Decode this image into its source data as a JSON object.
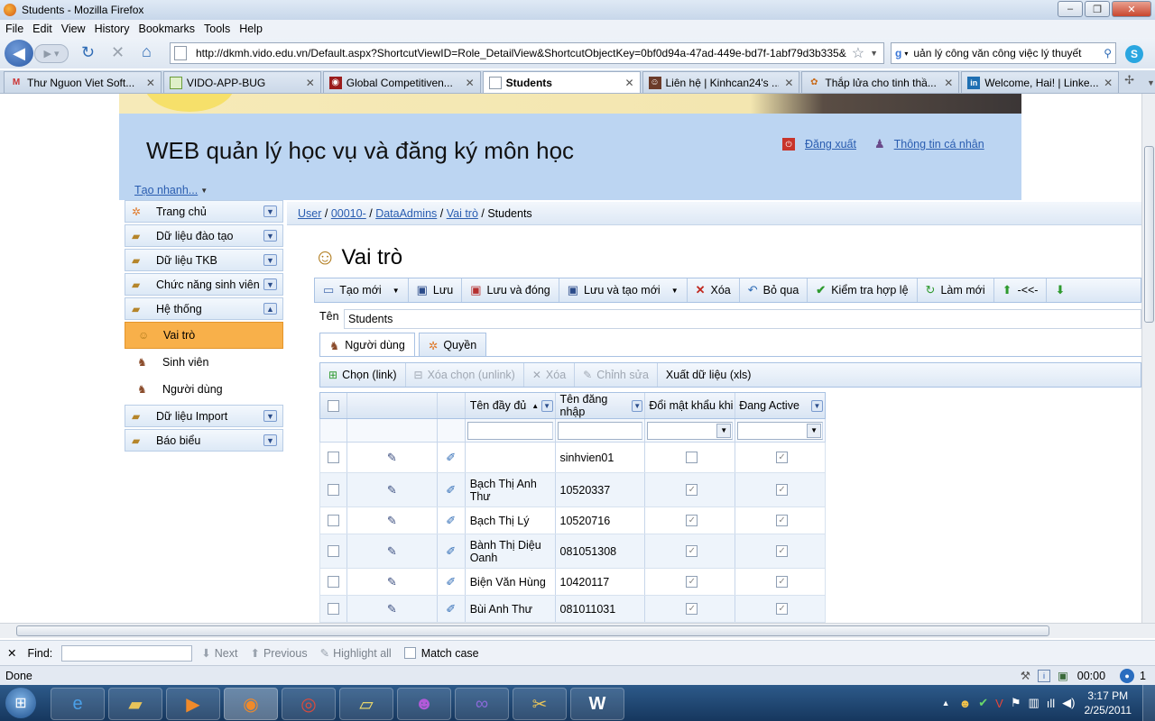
{
  "browser": {
    "window_title": "Students - Mozilla Firefox",
    "menu": [
      "File",
      "Edit",
      "View",
      "History",
      "Bookmarks",
      "Tools",
      "Help"
    ],
    "url": "http://dkmh.vido.edu.vn/Default.aspx?ShortcutViewID=Role_DetailView&ShortcutObjectKey=0bf0d94a-47ad-449e-bd7f-1abf79d3b335&",
    "search": "uản lý công văn công việc lý thuyết",
    "tabs": [
      {
        "label": "Thư Nguon Viet Soft...",
        "icon": "gmail-icon"
      },
      {
        "label": "VIDO-APP-BUG",
        "icon": "page-icon"
      },
      {
        "label": "Global Competitiven...",
        "icon": "site-icon"
      },
      {
        "label": "Students",
        "icon": "page-icon",
        "active": true
      },
      {
        "label": "Liên hệ | Kinhcan24's ...",
        "icon": "site-icon"
      },
      {
        "label": "Thắp lửa cho tinh thầ...",
        "icon": "site-icon"
      },
      {
        "label": "Welcome, Hai! | Linke...",
        "icon": "linkedin-icon"
      }
    ]
  },
  "app": {
    "title": "WEB quản lý học vụ và đăng ký môn học",
    "logout": "Đăng xuất",
    "profile": "Thông tin cá nhân",
    "quick": "Tạo nhanh...",
    "sidebar": {
      "groups": [
        {
          "label": "Trang chủ"
        },
        {
          "label": "Dữ liệu đào tạo"
        },
        {
          "label": "Dữ liệu TKB"
        },
        {
          "label": "Chức năng sinh viên"
        },
        {
          "label": "Hệ thống"
        }
      ],
      "subitems": [
        {
          "label": "Vai trò"
        },
        {
          "label": "Sinh viên"
        },
        {
          "label": "Người dùng"
        }
      ],
      "groups_after": [
        {
          "label": "Dữ liệu Import"
        },
        {
          "label": "Báo biểu"
        }
      ]
    },
    "breadcrumb": {
      "items": [
        "User",
        "00010-",
        "DataAdmins",
        "Vai trò"
      ],
      "current": "Students"
    },
    "view_title": "Vai trò",
    "toolbar": [
      "Tạo mới",
      "Lưu",
      "Lưu và đóng",
      "Lưu và tạo mới",
      "Xóa",
      "Bỏ qua",
      "Kiểm tra hợp lệ",
      "Làm mới",
      "-<<-"
    ],
    "name_label": "Tên",
    "name_value": "Students",
    "subtabs": [
      "Người dùng",
      "Quyền"
    ],
    "subtoolbar": [
      "Chọn (link)",
      "Xóa chọn (unlink)",
      "Xóa",
      "Chỉnh sửa",
      "Xuất dữ liệu (xls)"
    ],
    "grid": {
      "headers": [
        "Tên đầy đủ",
        "Tên đăng nhập",
        "Đổi mật khẩu khi",
        "Đang Active"
      ],
      "rows": [
        {
          "fullname": "",
          "username": "sinhvien01",
          "change_pw": false,
          "active": true
        },
        {
          "fullname": "Bạch Thị Anh Thư",
          "username": "10520337",
          "change_pw": true,
          "active": true
        },
        {
          "fullname": "Bạch Thị Lý",
          "username": "10520716",
          "change_pw": true,
          "active": true
        },
        {
          "fullname": "Bành Thị Diệu Oanh",
          "username": "081051308",
          "change_pw": true,
          "active": true
        },
        {
          "fullname": "Biện Văn Hùng",
          "username": "10420117",
          "change_pw": true,
          "active": true
        },
        {
          "fullname": "Bùi Anh Thư",
          "username": "081011031",
          "change_pw": true,
          "active": true
        }
      ]
    }
  },
  "findbar": {
    "label": "Find:",
    "next": "Next",
    "previous": "Previous",
    "highlight": "Highlight all",
    "match": "Match case"
  },
  "status": {
    "text": "Done",
    "timer": "00:00",
    "count": "1"
  },
  "clock": {
    "time": "3:17 PM",
    "date": "2/25/2011"
  }
}
